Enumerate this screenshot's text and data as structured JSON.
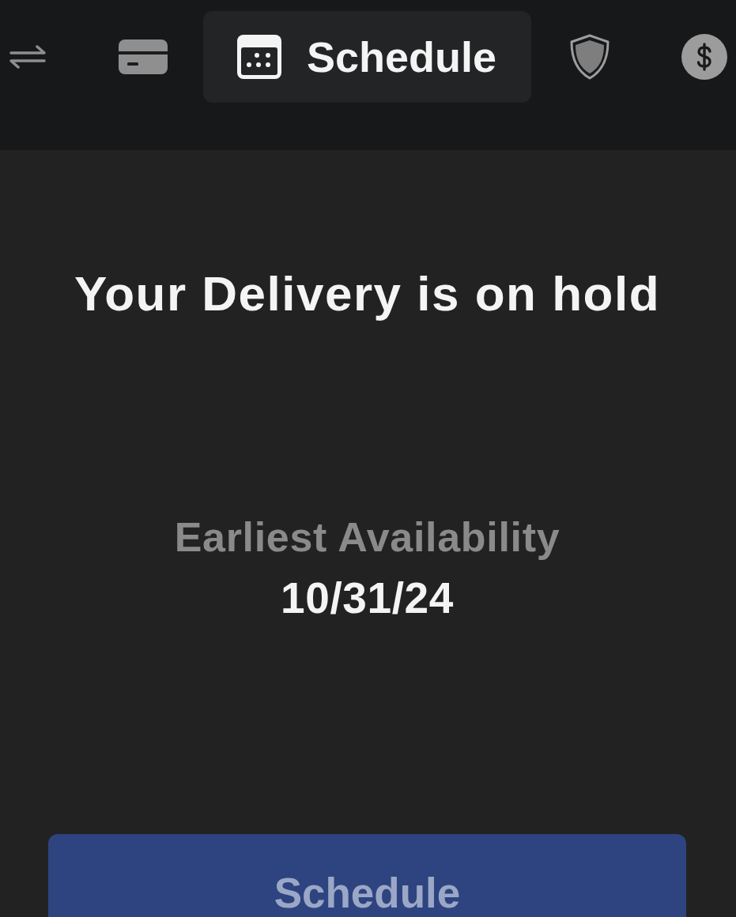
{
  "tabs": [
    {
      "kind": "transfer",
      "selected": false
    },
    {
      "kind": "card",
      "selected": false
    },
    {
      "kind": "calendar",
      "label": "Schedule",
      "selected": true
    },
    {
      "kind": "shield",
      "selected": false
    },
    {
      "kind": "dollar",
      "selected": false
    }
  ],
  "status": {
    "title": "Your Delivery is on hold",
    "availability_label": "Earliest Availability",
    "availability_date": "10/31/24"
  },
  "action_button": {
    "label": "Schedule",
    "disabled": true
  }
}
